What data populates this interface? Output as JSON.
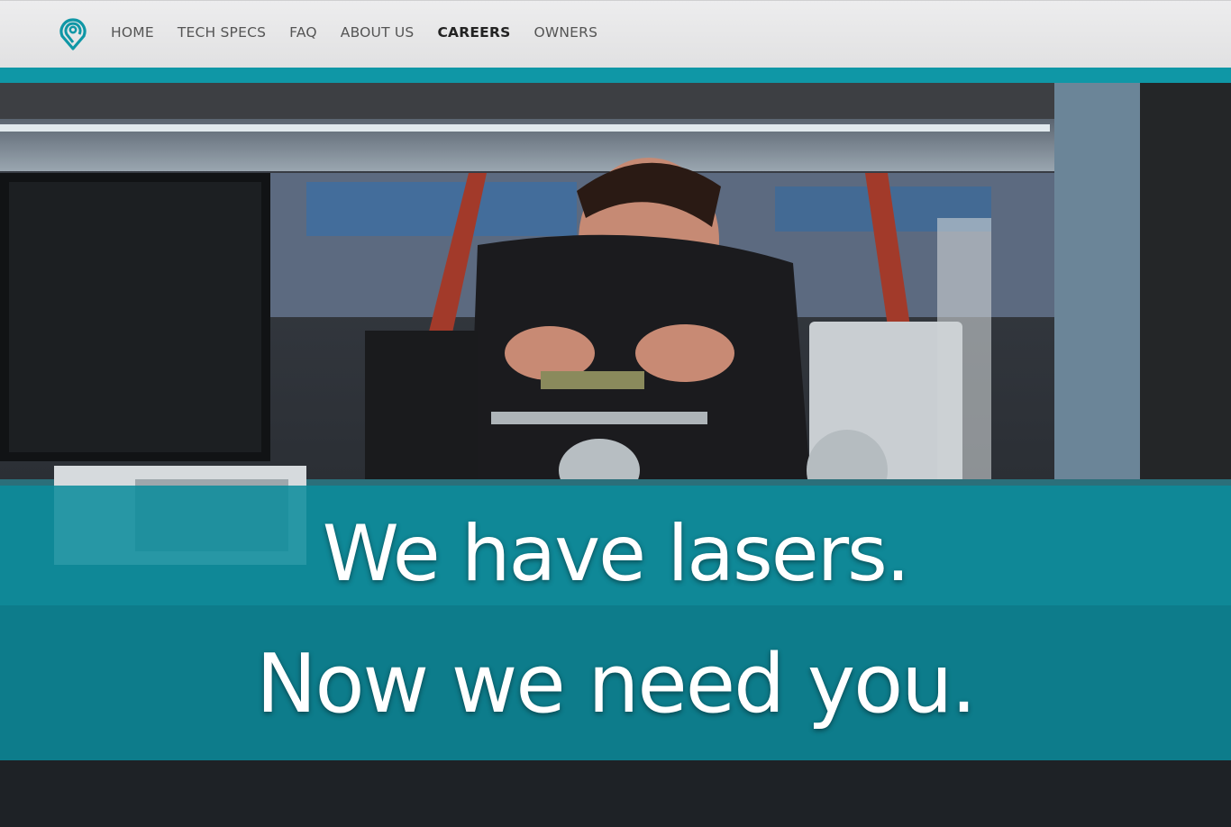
{
  "nav": {
    "logo_icon": "location-pin-logo-icon",
    "items": [
      {
        "label": "HOME",
        "active": false
      },
      {
        "label": "TECH SPECS",
        "active": false
      },
      {
        "label": "FAQ",
        "active": false
      },
      {
        "label": "ABOUT US",
        "active": false
      },
      {
        "label": "CAREERS",
        "active": true
      },
      {
        "label": "OWNERS",
        "active": false
      }
    ]
  },
  "hero": {
    "image": "woman-soldering-circuit-board-photo",
    "headline_line1": "We have lasers.",
    "headline_line2": "Now we need you."
  },
  "colors": {
    "accent": "#0f97a6",
    "banner": "#0b8c9c",
    "nav_bg": "#e8e8e9",
    "nav_text": "#555555",
    "nav_active_text": "#232323"
  }
}
